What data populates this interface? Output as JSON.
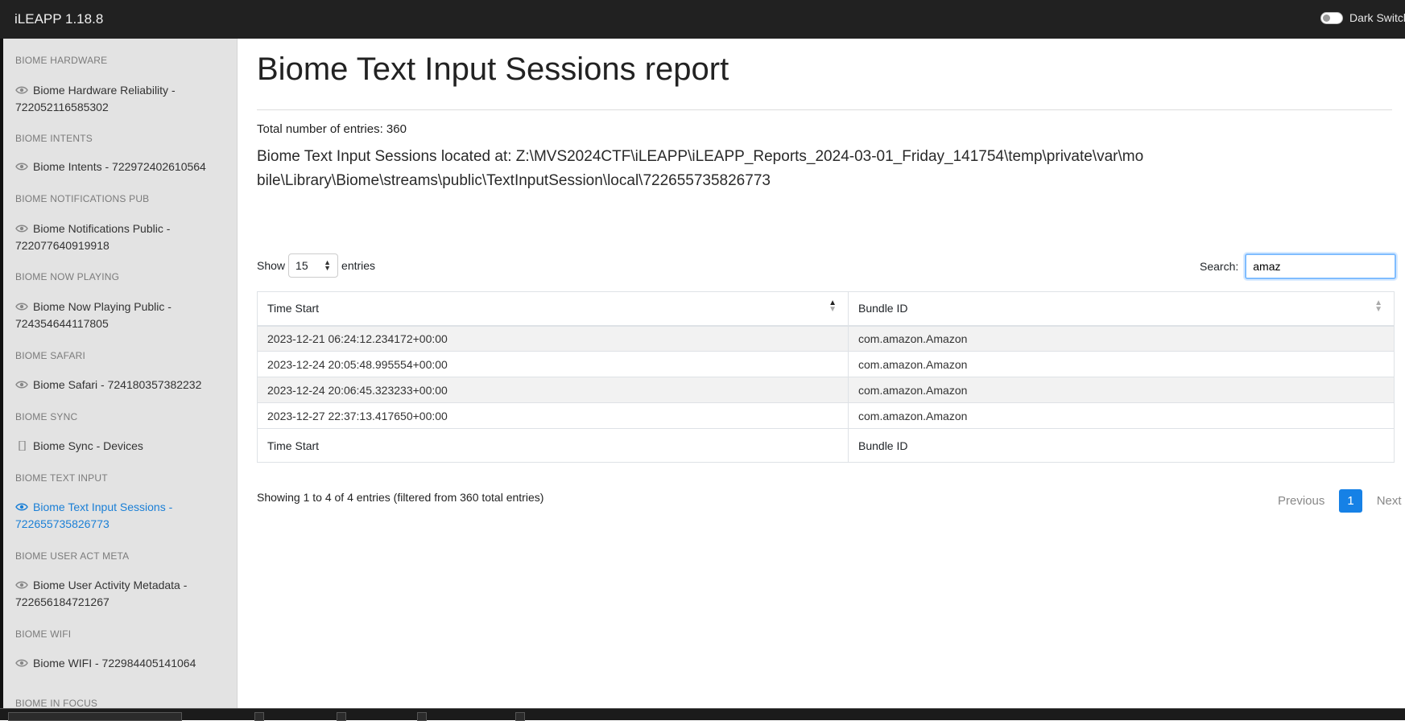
{
  "app": {
    "title": "iLEAPP 1.18.8",
    "dark_switch_label": "Dark Switch"
  },
  "sidebar": {
    "sections": [
      {
        "heading": "BIOME HARDWARE",
        "items": [
          {
            "label": "Biome Hardware Reliability - 722052116585302",
            "icon": "eye-icon"
          }
        ]
      },
      {
        "heading": "BIOME INTENTS",
        "items": [
          {
            "label": "Biome Intents - 722972402610564",
            "icon": "eye-icon"
          }
        ]
      },
      {
        "heading": "BIOME NOTIFICATIONS PUB",
        "items": [
          {
            "label": "Biome Notifications Public - 722077640919918",
            "icon": "eye-icon"
          }
        ]
      },
      {
        "heading": "BIOME NOW PLAYING",
        "items": [
          {
            "label": "Biome Now Playing Public - 724354644117805",
            "icon": "eye-icon"
          }
        ]
      },
      {
        "heading": "BIOME SAFARI",
        "items": [
          {
            "label": "Biome Safari - 724180357382232",
            "icon": "eye-icon"
          }
        ]
      },
      {
        "heading": "BIOME SYNC",
        "items": [
          {
            "label": "Biome Sync - Devices",
            "icon": "phone-icon"
          }
        ]
      },
      {
        "heading": "BIOME TEXT INPUT",
        "items": [
          {
            "label": "Biome Text Input Sessions - 722655735826773",
            "icon": "eye-icon",
            "active": true
          }
        ]
      },
      {
        "heading": "BIOME USER ACT META",
        "items": [
          {
            "label": "Biome User Activity Metadata - 722656184721267",
            "icon": "eye-icon"
          }
        ]
      },
      {
        "heading": "BIOME WIFI",
        "items": [
          {
            "label": "Biome WIFI - 722984405141064",
            "icon": "eye-icon"
          }
        ]
      },
      {
        "heading": "BIOME IN FOCUS",
        "items": []
      }
    ]
  },
  "report": {
    "title": "Biome Text Input Sessions report",
    "total_entries": "Total number of entries: 360",
    "location": "Biome Text Input Sessions located at: Z:\\MVS2024CTF\\iLEAPP\\iLEAPP_Reports_2024-03-01_Friday_141754\\temp\\private\\var\\mobile\\Library\\Biome\\streams\\public\\TextInputSession\\local\\722655735826773"
  },
  "table_controls": {
    "show_label": "Show",
    "page_size": "15",
    "entries_label": "entries",
    "search_label": "Search:",
    "search_value": "amaz"
  },
  "table": {
    "columns": [
      "Time Start",
      "Bundle ID"
    ],
    "rows": [
      [
        "2023-12-21 06:24:12.234172+00:00",
        "com.amazon.Amazon"
      ],
      [
        "2023-12-24 20:05:48.995554+00:00",
        "com.amazon.Amazon"
      ],
      [
        "2023-12-24 20:06:45.323233+00:00",
        "com.amazon.Amazon"
      ],
      [
        "2023-12-27 22:37:13.417650+00:00",
        "com.amazon.Amazon"
      ]
    ]
  },
  "pagination": {
    "info": "Showing 1 to 4 of 4 entries (filtered from 360 total entries)",
    "previous": "Previous",
    "current": "1",
    "next": "Next"
  },
  "colors": {
    "accent": "#1681e6",
    "active_link": "#1a7fd6",
    "topbar": "#212121",
    "sidebar": "#e3e3e3"
  }
}
